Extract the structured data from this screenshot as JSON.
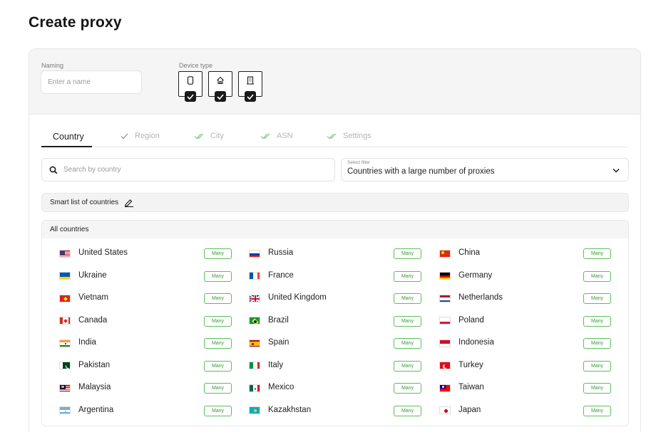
{
  "page": {
    "title": "Create proxy"
  },
  "naming": {
    "label": "Naming",
    "placeholder": "Enter a name"
  },
  "device_type": {
    "label": "Device type",
    "items": [
      {
        "icon": "mobile-phone-icon",
        "checked": true
      },
      {
        "icon": "home-icon",
        "checked": true
      },
      {
        "icon": "office-building-icon",
        "checked": true
      }
    ]
  },
  "tabs": [
    {
      "label": "Country",
      "active": true
    },
    {
      "label": "Region",
      "check": "single"
    },
    {
      "label": "City",
      "check": "double"
    },
    {
      "label": "ASN",
      "check": "double"
    },
    {
      "label": "Settings",
      "check": "double"
    }
  ],
  "search": {
    "placeholder": "Search by country"
  },
  "filter": {
    "label": "Select filter",
    "value": "Countries with a large number of proxies"
  },
  "smart_list": {
    "label": "Smart list of countries"
  },
  "all_countries": {
    "label": "All countries",
    "badge_label": "Many",
    "countries": [
      {
        "name": "United States",
        "flag": "us"
      },
      {
        "name": "Russia",
        "flag": "ru"
      },
      {
        "name": "China",
        "flag": "cn"
      },
      {
        "name": "Ukraine",
        "flag": "ua"
      },
      {
        "name": "France",
        "flag": "fr"
      },
      {
        "name": "Germany",
        "flag": "de"
      },
      {
        "name": "Vietnam",
        "flag": "vn"
      },
      {
        "name": "United Kingdom",
        "flag": "gb"
      },
      {
        "name": "Netherlands",
        "flag": "nl"
      },
      {
        "name": "Canada",
        "flag": "ca"
      },
      {
        "name": "Brazil",
        "flag": "br"
      },
      {
        "name": "Poland",
        "flag": "pl"
      },
      {
        "name": "India",
        "flag": "in"
      },
      {
        "name": "Spain",
        "flag": "es"
      },
      {
        "name": "Indonesia",
        "flag": "id"
      },
      {
        "name": "Pakistan",
        "flag": "pk"
      },
      {
        "name": "Italy",
        "flag": "it"
      },
      {
        "name": "Turkey",
        "flag": "tr"
      },
      {
        "name": "Malaysia",
        "flag": "my"
      },
      {
        "name": "Mexico",
        "flag": "mx"
      },
      {
        "name": "Taiwan",
        "flag": "tw"
      },
      {
        "name": "Argentina",
        "flag": "ar"
      },
      {
        "name": "Kazakhstan",
        "flag": "kz"
      },
      {
        "name": "Japan",
        "flag": "jp"
      }
    ]
  },
  "colors": {
    "accent_green": "#5abf5a",
    "tab_check_green": "#7dc77d",
    "text_dark": "#1e1e1e"
  }
}
